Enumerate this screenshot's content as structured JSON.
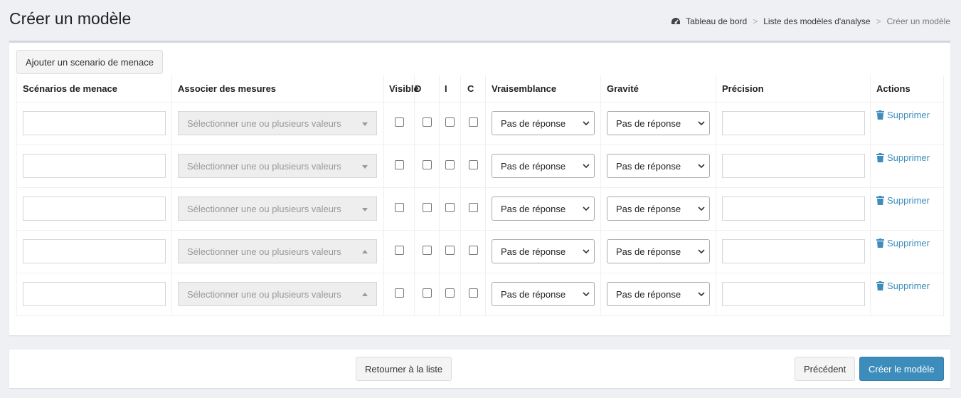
{
  "header": {
    "title": "Créer un modèle",
    "breadcrumb": [
      "Tableau de bord",
      "Liste des modèles d'analyse",
      "Créer un modèle"
    ],
    "separator": ">"
  },
  "toolbar": {
    "add_label": "Ajouter un scenario de menace"
  },
  "table": {
    "columns": [
      "Scénarios de menace",
      "Associer des mesures",
      "Visible",
      "D",
      "I",
      "C",
      "Vraisemblance",
      "Gravité",
      "Précision",
      "Actions"
    ],
    "multiselect_placeholder": "Sélectionner une ou plusieurs valeurs",
    "select_default": "Pas de réponse",
    "delete_label": "Supprimer",
    "rows": [
      {
        "scenario": "",
        "likelihood": "Pas de réponse",
        "severity": "Pas de réponse",
        "precision": "",
        "dropdown_open": false
      },
      {
        "scenario": "",
        "likelihood": "Pas de réponse",
        "severity": "Pas de réponse",
        "precision": "",
        "dropdown_open": false
      },
      {
        "scenario": "",
        "likelihood": "Pas de réponse",
        "severity": "Pas de réponse",
        "precision": "",
        "dropdown_open": false
      },
      {
        "scenario": "",
        "likelihood": "Pas de réponse",
        "severity": "Pas de réponse",
        "precision": "",
        "dropdown_open": true
      },
      {
        "scenario": "",
        "likelihood": "Pas de réponse",
        "severity": "Pas de réponse",
        "precision": "",
        "dropdown_open": true
      }
    ]
  },
  "footer": {
    "back_label": "Retourner à la liste",
    "prev_label": "Précédent",
    "create_label": "Créer le modèle"
  },
  "colors": {
    "accent": "#3c8dbc",
    "background": "#eef0f4"
  }
}
